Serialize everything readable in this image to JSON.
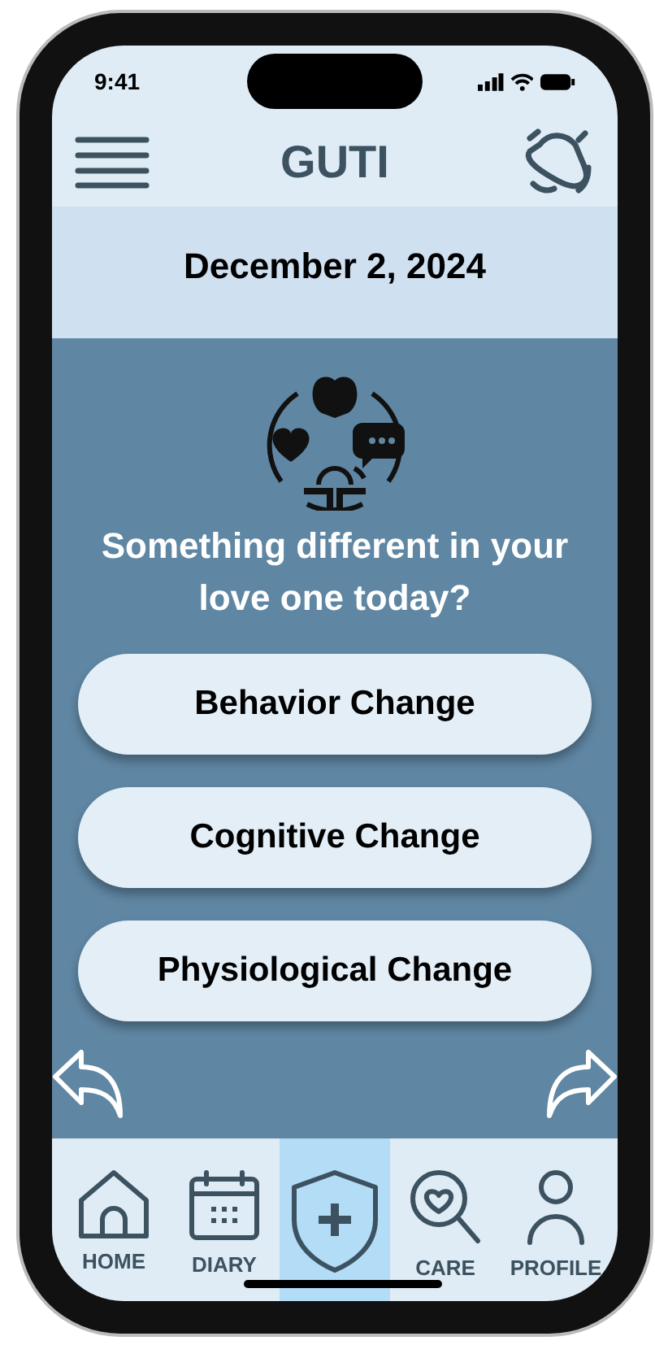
{
  "status_bar": {
    "time": "9:41"
  },
  "header": {
    "title": "GUTI"
  },
  "date": "December 2, 2024",
  "prompt": "Something different in your love one today?",
  "options": [
    {
      "label": "Behavior Change"
    },
    {
      "label": "Cognitive Change"
    },
    {
      "label": "Physiological Change"
    }
  ],
  "tab_bar": [
    {
      "kind": "home",
      "label": "HOME",
      "selected": false
    },
    {
      "kind": "diary",
      "label": "DIARY",
      "selected": false
    },
    {
      "kind": "add",
      "selected": true
    },
    {
      "kind": "care",
      "label": "CARE",
      "selected": false
    },
    {
      "kind": "profile",
      "label": "PROFILE",
      "selected": false
    }
  ]
}
